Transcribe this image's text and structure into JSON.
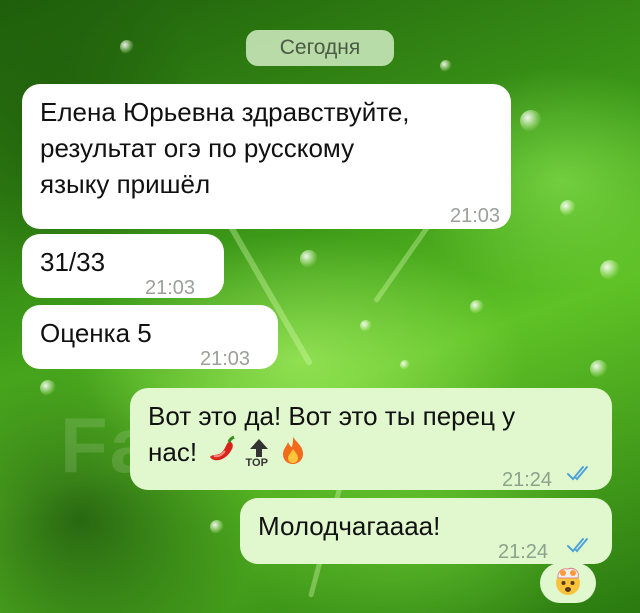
{
  "chat": {
    "date_label": "Сегодня",
    "messages": [
      {
        "direction": "incoming",
        "text": "Елена Юрьевна здравствуйте,\nрезультат огэ по русскому\nязыку пришёл",
        "time": "21:03"
      },
      {
        "direction": "incoming",
        "text": "31/33",
        "time": "21:03"
      },
      {
        "direction": "incoming",
        "text": "Оценка 5",
        "time": "21:03"
      },
      {
        "direction": "outgoing",
        "text_line1": "Вот это да! Вот это ты перец у",
        "text_line2": "нас!",
        "emojis": [
          "hot-pepper-icon",
          "top-arrow-icon",
          "fire-icon"
        ],
        "top_label": "TOP",
        "time": "21:24",
        "status": "read"
      },
      {
        "direction": "outgoing",
        "text": "Молодчагаааа!",
        "time": "21:24",
        "status": "read"
      }
    ],
    "reaction": "exploding-head-icon"
  },
  "watermark": "Farpost.ru",
  "colors": {
    "incoming_bubble": "#ffffff",
    "outgoing_bubble": "#e1f8cf",
    "read_ticks": "#4fa3d9",
    "date_pill": "#d7f0c8"
  }
}
